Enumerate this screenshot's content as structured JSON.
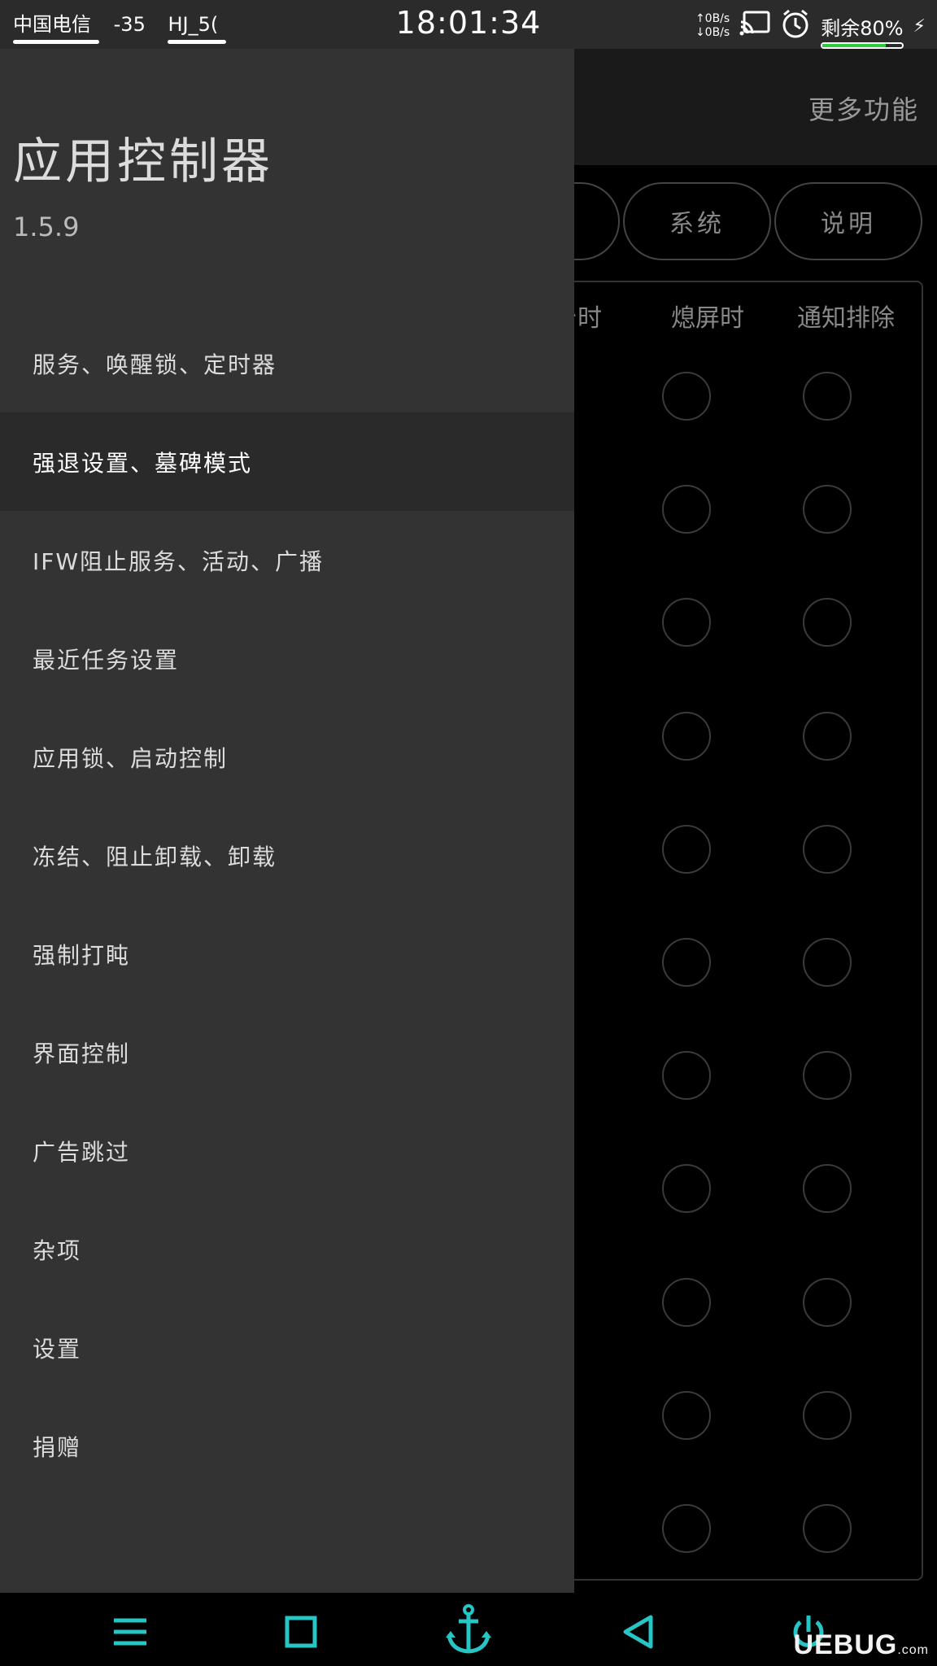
{
  "status_bar": {
    "carrier": "中国电信",
    "signal": "-35",
    "wifi_name": "HJ_5(",
    "time": "18:01:34",
    "net_up": "0B/s",
    "net_down": "0B/s",
    "battery_label": "剩余80%",
    "battery_level": 0.8,
    "battery_color": "#2ecc40",
    "icons": [
      "cast-icon",
      "alarm-clock-icon",
      "charging-bolt-icon"
    ]
  },
  "header": {
    "more_functions": "更多功能"
  },
  "tabs": [
    {
      "label": ""
    },
    {
      "label": "系统"
    },
    {
      "label": "说明"
    }
  ],
  "columns": [
    "台时",
    "熄屏时",
    "通知排除"
  ],
  "row_count": 11,
  "drawer": {
    "title": "应用控制器",
    "version": "1.5.9",
    "items": [
      {
        "label": "服务、唤醒锁、定时器"
      },
      {
        "label": "强退设置、墓碑模式",
        "active": true
      },
      {
        "label": "IFW阻止服务、活动、广播"
      },
      {
        "label": "最近任务设置"
      },
      {
        "label": "应用锁、启动控制"
      },
      {
        "label": "冻结、阻止卸载、卸载"
      },
      {
        "label": "强制打盹"
      },
      {
        "label": "界面控制"
      },
      {
        "label": "广告跳过"
      },
      {
        "label": "杂项"
      },
      {
        "label": "设置"
      },
      {
        "label": "捐赠"
      }
    ]
  },
  "nav_bar": {
    "accent_color": "#26c6c6",
    "buttons": [
      "menu-icon",
      "home-square-icon",
      "anchor-icon",
      "back-triangle-icon",
      "power-icon"
    ]
  },
  "watermark": {
    "text": "UEBUG",
    "suffix": ".com"
  }
}
